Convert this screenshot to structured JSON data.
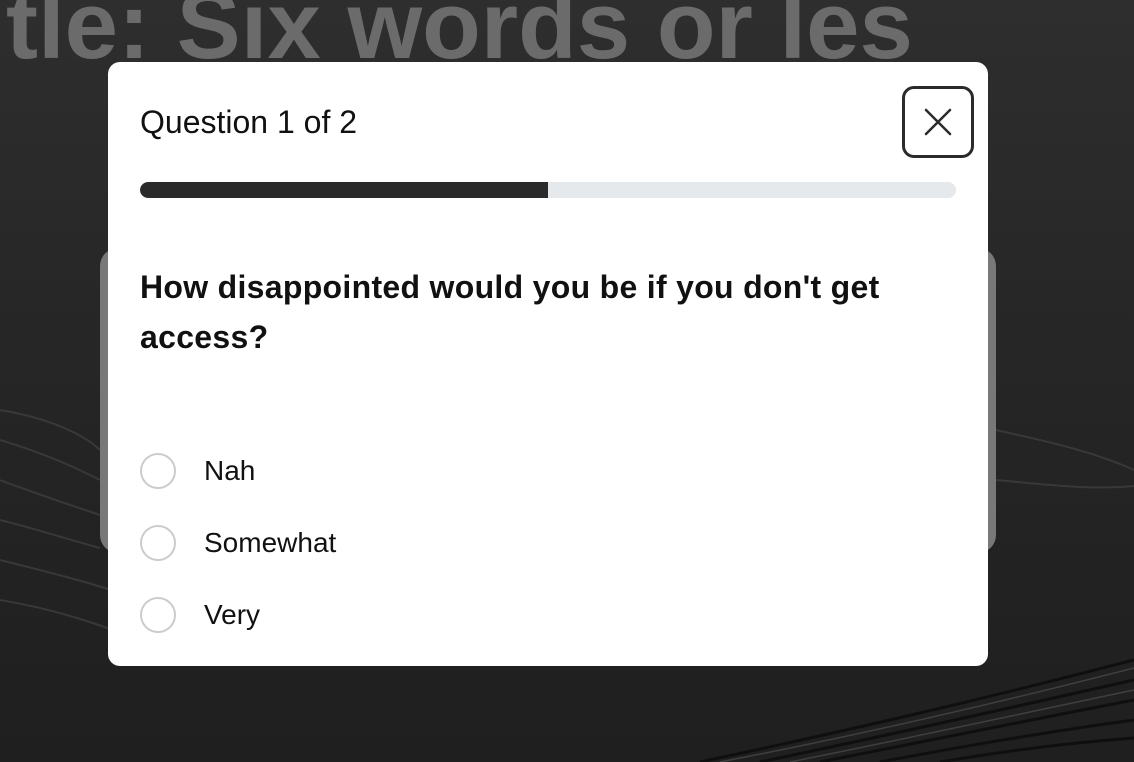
{
  "background": {
    "title_text": "tle: Six words or les",
    "colors": {
      "page": "#2a2a2a",
      "title": "#6b6b6b",
      "card": "#787878"
    }
  },
  "modal": {
    "counter": "Question 1 of 2",
    "close_icon": "close-icon",
    "progress": {
      "current": 1,
      "total": 2,
      "fraction": 0.5
    },
    "question": "How disappointed would you be if you don't get access?",
    "options": [
      {
        "label": "Nah",
        "selected": false
      },
      {
        "label": "Somewhat",
        "selected": false
      },
      {
        "label": "Very",
        "selected": false
      }
    ],
    "colors": {
      "surface": "#ffffff",
      "progress_fill": "#2b2b2b",
      "progress_track": "#e6e9ec",
      "radio_border": "#c9cccf",
      "text": "#111111"
    }
  }
}
